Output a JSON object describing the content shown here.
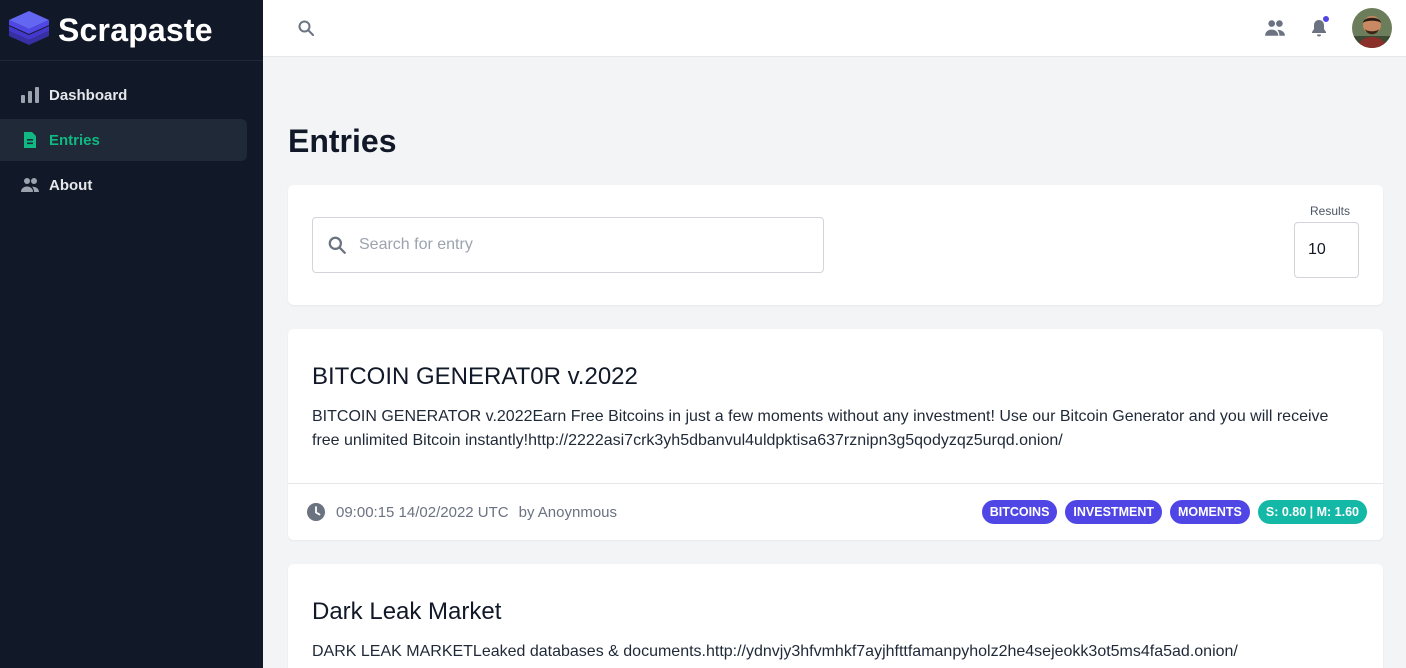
{
  "brand": {
    "name": "Scrapaste",
    "logo_icon": "layers-icon"
  },
  "sidebar": {
    "items": [
      {
        "label": "Dashboard",
        "icon": "bar-chart-icon",
        "active": false
      },
      {
        "label": "Entries",
        "icon": "document-icon",
        "active": true
      },
      {
        "label": "About",
        "icon": "users-icon",
        "active": false
      }
    ]
  },
  "topbar": {
    "search_icon": "search-icon",
    "icons": [
      "users-icon",
      "bell-icon",
      "avatar"
    ]
  },
  "page": {
    "title": "Entries"
  },
  "filters": {
    "search_placeholder": "Search for entry",
    "results_label": "Results",
    "results_value": "10"
  },
  "colors": {
    "sidebar_bg": "#111827",
    "active_accent": "#10b981",
    "tag_bg": "#4f46e5",
    "score_bg": "#14b8a6"
  },
  "entries": [
    {
      "title": "BITCOIN GENERAT0R v.2022",
      "text": "BITCOIN GENERATOR v.2022Earn Free Bitcoins in just a few moments without any investment! Use our Bitcoin Generator and you will receive free unlimited Bitcoin instantly!http://2222asi7crk3yh5dbanvul4uldpktisa637rznipn3g5qodyzqz5urqd.onion/",
      "timestamp": "09:00:15 14/02/2022 UTC",
      "author": "by Anoynmous",
      "tags": [
        "BITCOINS",
        "INVESTMENT",
        "MOMENTS"
      ],
      "score": "S: 0.80 | M: 1.60"
    },
    {
      "title": "Dark Leak Market",
      "text": "DARK LEAK MARKETLeaked databases & documents.http://ydnvjy3hfvmhkf7ayjhfttfamanpyholz2he4sejeokk3ot5ms4fa5ad.onion/"
    }
  ]
}
